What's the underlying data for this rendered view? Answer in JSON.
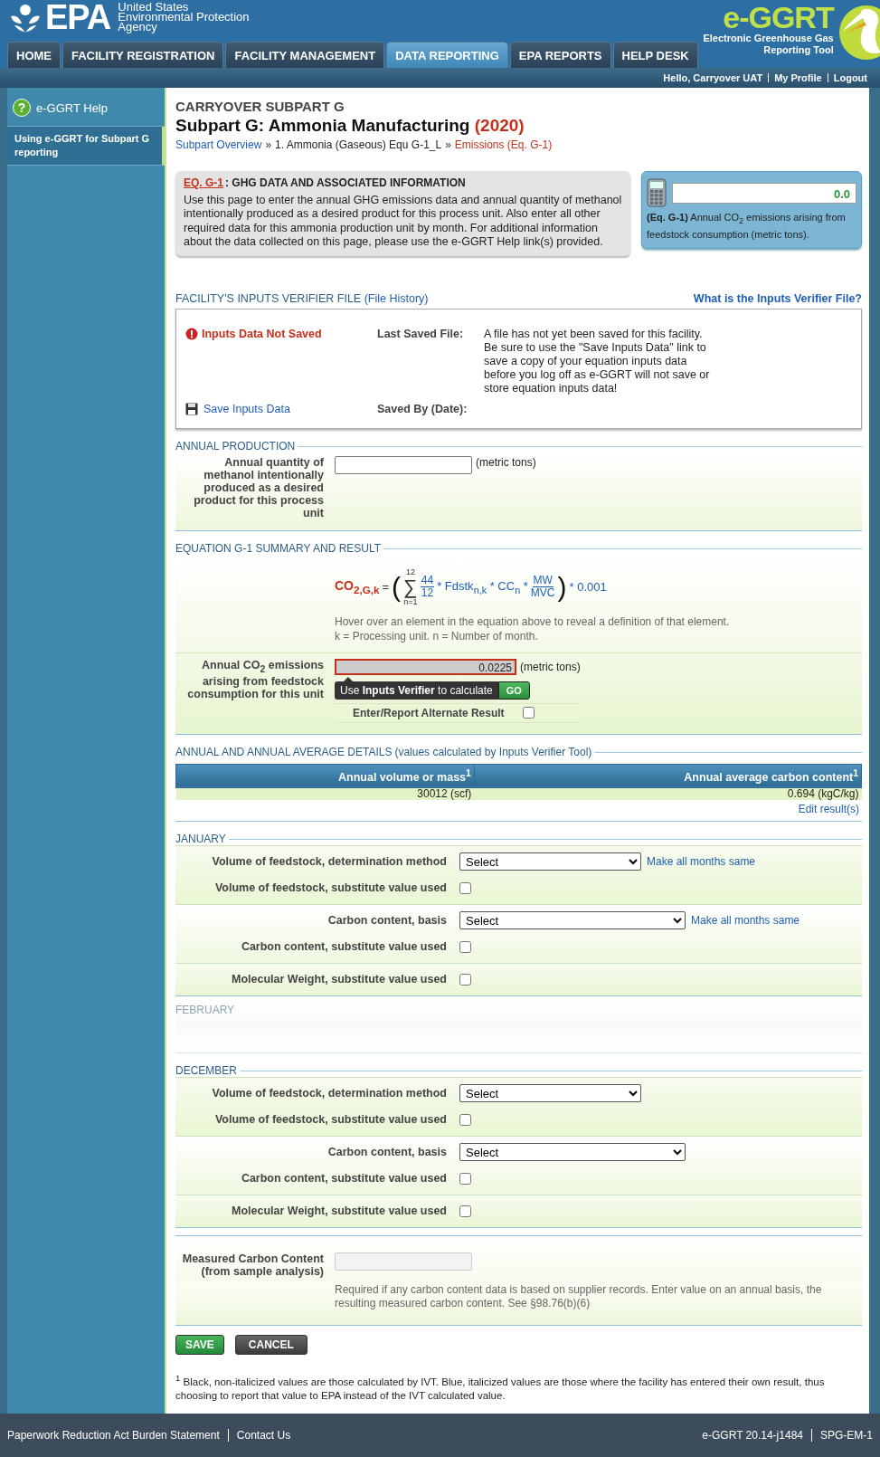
{
  "header": {
    "agency_mark": "EPA",
    "agency_lines": [
      "United States",
      "Environmental Protection",
      "Agency"
    ],
    "app_logo": "e-GGRT",
    "app_subtitle": "Electronic Greenhouse Gas Reporting Tool",
    "nav_tabs": [
      {
        "label": "HOME",
        "selected": false
      },
      {
        "label": "FACILITY REGISTRATION",
        "selected": false
      },
      {
        "label": "FACILITY MANAGEMENT",
        "selected": false
      },
      {
        "label": "DATA REPORTING",
        "selected": true
      },
      {
        "label": "EPA REPORTS",
        "selected": false
      },
      {
        "label": "HELP DESK",
        "selected": false
      }
    ],
    "user_links": [
      "Hello, Carryover UAT",
      "My Profile",
      "Logout"
    ]
  },
  "sidebar": {
    "help_icon": "?",
    "help_title": "e-GGRT Help",
    "items": [
      {
        "label": "Using e-GGRT for Subpart G reporting"
      }
    ]
  },
  "page": {
    "kicker": "CARRYOVER SUBPART G",
    "title": "Subpart G: Ammonia Manufacturing",
    "year": "(2020)",
    "breadcrumb": [
      {
        "label": "Subpart Overview",
        "kind": "link",
        "separator": "»"
      },
      {
        "label": "1. Ammonia (Gaseous) Equ G-1_L",
        "kind": "text",
        "separator": "»"
      },
      {
        "label": "Emissions (Eq. G-1)",
        "kind": "current"
      }
    ]
  },
  "info_box": {
    "link": "EQ. G-1",
    "title": ": GHG DATA AND ASSOCIATED INFORMATION",
    "text": "Use this page to enter the annual GHG emissions data and annual quantity of methanol intentionally produced as a desired product for this process unit. Also enter all other required data for this ammonia production unit by month. For additional information about the data collected on this page, please use the e-GGRT Help link(s) provided."
  },
  "result_box": {
    "value": "0.0",
    "caption": "**(Eq. G-1)** Annual CO$_{2}$ emissions arising from feedstock consumption (metric tons)."
  },
  "verifier": {
    "title": "FACILITY'S INPUTS VERIFIER FILE",
    "history_link": "(File History)",
    "help_link": "What is the Inputs Verifier File?",
    "status": "Inputs Data Not Saved",
    "save_link": "Save Inputs Data",
    "last_saved_label": "Last Saved File:",
    "last_saved_text": "A file has not yet been saved for this facility. Be sure to use the \"Save Inputs Data\" link to save a copy of your equation inputs data before you log off as e-GGRT will not save or store equation inputs data!",
    "saved_by_label": "Saved By (Date):"
  },
  "annual_production": {
    "title": "ANNUAL PRODUCTION",
    "label": "Annual quantity of methanol intentionally produced as a desired product for this process unit",
    "unit": "(metric tons)"
  },
  "equation": {
    "title": "EQUATION G-1 SUMMARY AND RESULT",
    "formula": {
      "lhs": "CO$_{2,G,k}$",
      "equals": "=",
      "open": "(",
      "sum_sign": "∑",
      "sum_upper": "12",
      "sum_lower": "n=1",
      "terms": [
        {
          "kind": "frac",
          "num": "44",
          "den": "12"
        },
        {
          "kind": "text",
          "text": "* Fdstk$_{n,k}$ * CC$_{n}$ *"
        },
        {
          "kind": "frac",
          "num": "MW",
          "den": "MVC"
        }
      ],
      "close": ")",
      "tail": "* 0.001"
    },
    "hint": "Hover over an element in the equation above to reveal a definition of that element.",
    "legend": "k = Processing unit. n = Number of month.",
    "result_label": "Annual CO$_{2}$ emissions arising from feedstock consumption for this unit",
    "result_value": "0.0225",
    "unit": "(metric tons)",
    "verifier_prompt": "Use **Inputs Verifier** to calculate",
    "go": "GO",
    "alternate_label": "Enter/Report Alternate Result",
    "alternate_checked": false
  },
  "details": {
    "title": "ANNUAL AND ANNUAL AVERAGE DETAILS",
    "subtitle": "(values calculated by Inputs Verifier Tool)",
    "columns": [
      "Annual volume or mass$^{1}$",
      "Annual average carbon content$^{1}$"
    ],
    "rows": [
      [
        "30012 (scf)",
        "0.694 (kgC/kg)"
      ]
    ],
    "edit_link": "Edit result(s)"
  },
  "months": [
    {
      "name": "JANUARY",
      "kind": "full",
      "groups": [
        [
          {
            "kind": "select",
            "label": "Volume of feedstock, determination method",
            "value": "Select",
            "link": "Make all months same"
          },
          {
            "kind": "checkbox",
            "label": "Volume of feedstock, substitute value used",
            "checked": false
          }
        ],
        [
          {
            "kind": "select",
            "label": "Carbon content, basis",
            "value": "Select",
            "link": "Make all months same"
          },
          {
            "kind": "checkbox",
            "label": "Carbon content, substitute value used",
            "checked": false
          }
        ],
        [
          {
            "kind": "checkbox",
            "label": "Molecular Weight, substitute value used",
            "checked": false
          }
        ]
      ]
    },
    {
      "name": "FEBRUARY",
      "kind": "faded"
    },
    {
      "name": "DECEMBER",
      "kind": "full",
      "groups": [
        [
          {
            "kind": "select",
            "label": "Volume of feedstock, determination method",
            "value": "Select"
          },
          {
            "kind": "checkbox",
            "label": "Volume of feedstock, substitute value used",
            "checked": false
          }
        ],
        [
          {
            "kind": "select",
            "label": "Carbon content, basis",
            "value": "Select"
          },
          {
            "kind": "checkbox",
            "label": "Carbon content, substitute value used",
            "checked": false
          }
        ],
        [
          {
            "kind": "checkbox",
            "label": "Molecular Weight, substitute value used",
            "checked": false
          }
        ]
      ]
    }
  ],
  "measured": {
    "label": "Measured Carbon Content (from sample analysis)",
    "note": "Required if any carbon content data is based on supplier records. Enter value on an annual basis, the resulting measured carbon content. See §98.76(b)(6)"
  },
  "buttons": [
    {
      "label": "SAVE",
      "kind": "primary"
    },
    {
      "label": "CANCEL",
      "kind": "secondary"
    }
  ],
  "footnote": "$^{1}$ Black, non-italicized values are those calculated by IVT. Blue, italicized values are those where the facility has entered their own result, thus choosing to report that value to EPA instead of the IVT calculated value.",
  "footer": {
    "links": [
      "Paperwork Reduction Act Burden Statement",
      "Contact Us"
    ],
    "version": [
      "e-GGRT 20.14-j1484",
      "SPG-EM-1"
    ]
  }
}
